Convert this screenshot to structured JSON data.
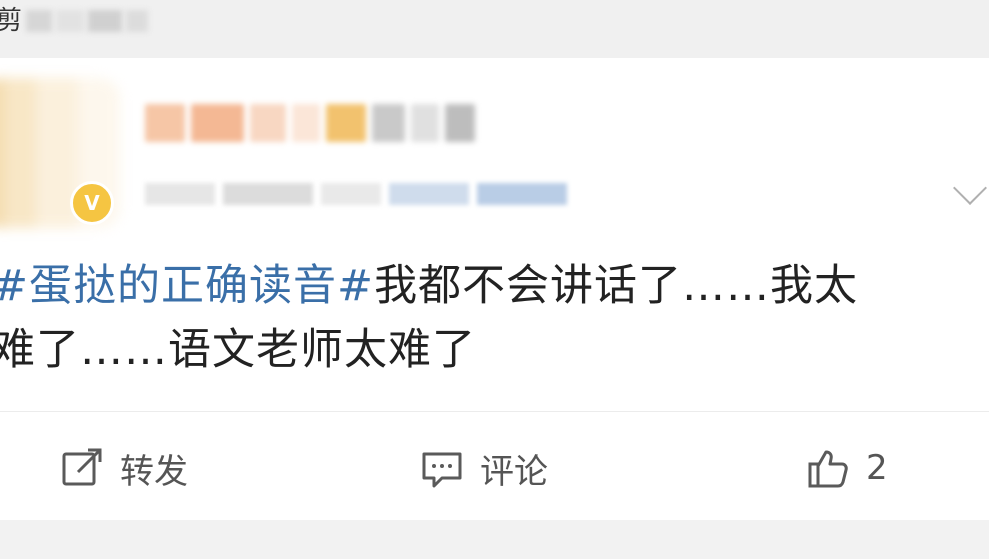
{
  "top_strip": {
    "partial_label": "剪"
  },
  "post": {
    "hashtag": "#蛋挞的正确读音#",
    "body_line1_rest": "我都不会讲话了……我太",
    "body_line2": "难了……语文老师太难了"
  },
  "actions": {
    "repost_label": "转发",
    "comment_label": "评论",
    "like_count": "2"
  },
  "colors": {
    "hashtag": "#3a6fa8",
    "text": "#222222",
    "action_text": "#555555",
    "vip_badge": "#f5c542"
  },
  "icons": {
    "repost": "share-edit-icon",
    "comment": "comment-icon",
    "like": "thumbs-up-icon",
    "more": "chevron-down-icon",
    "vip": "vip-badge-icon"
  }
}
